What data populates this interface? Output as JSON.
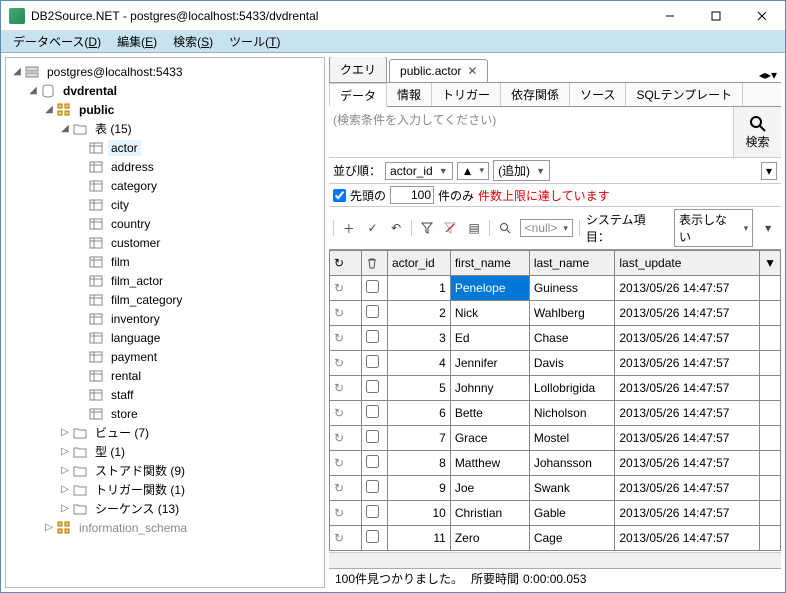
{
  "titlebar": {
    "app": "DB2Source.NET",
    "conn": "postgres@localhost:5433/dvdrental"
  },
  "menu": {
    "database": "データベース",
    "database_u": "D",
    "edit": "編集",
    "edit_u": "E",
    "search": "検索",
    "search_u": "S",
    "tool": "ツール",
    "tool_u": "T"
  },
  "tree": {
    "root": "postgres@localhost:5433",
    "db": "dvdrental",
    "schema": "public",
    "tables_label": "表 (15)",
    "tables": [
      "actor",
      "address",
      "category",
      "city",
      "country",
      "customer",
      "film",
      "film_actor",
      "film_category",
      "inventory",
      "language",
      "payment",
      "rental",
      "staff",
      "store"
    ],
    "views": "ビュー  (7)",
    "types": "型 (1)",
    "funcs": "ストアド関数  (9)",
    "trigs": "トリガー関数  (1)",
    "seqs": "シーケンス  (13)",
    "info": "information_schema",
    "selected_table": "actor"
  },
  "tabs": {
    "query": "クエリ",
    "actor": "public.actor"
  },
  "subtabs": [
    "データ",
    "情報",
    "トリガー",
    "依存関係",
    "ソース",
    "SQLテンプレート"
  ],
  "search": {
    "placeholder": "(検索条件を入力してください)",
    "btn": "検索"
  },
  "sort": {
    "label": "並び順：",
    "col": "actor_id",
    "add": "(追加)"
  },
  "limit": {
    "chk_label": "先頭の",
    "value": "100",
    "suffix": "件のみ",
    "warn": "件数上限に達しています"
  },
  "toolbar": {
    "null": "<null>",
    "sys_label": "システム項目：",
    "sys_value": "表示しない"
  },
  "grid": {
    "cols": [
      "actor_id",
      "first_name",
      "last_name",
      "last_update"
    ],
    "rows": [
      {
        "id": 1,
        "fn": "Penelope",
        "ln": "Guiness",
        "ts": "2013/05/26 14:47:57"
      },
      {
        "id": 2,
        "fn": "Nick",
        "ln": "Wahlberg",
        "ts": "2013/05/26 14:47:57"
      },
      {
        "id": 3,
        "fn": "Ed",
        "ln": "Chase",
        "ts": "2013/05/26 14:47:57"
      },
      {
        "id": 4,
        "fn": "Jennifer",
        "ln": "Davis",
        "ts": "2013/05/26 14:47:57"
      },
      {
        "id": 5,
        "fn": "Johnny",
        "ln": "Lollobrigida",
        "ts": "2013/05/26 14:47:57"
      },
      {
        "id": 6,
        "fn": "Bette",
        "ln": "Nicholson",
        "ts": "2013/05/26 14:47:57"
      },
      {
        "id": 7,
        "fn": "Grace",
        "ln": "Mostel",
        "ts": "2013/05/26 14:47:57"
      },
      {
        "id": 8,
        "fn": "Matthew",
        "ln": "Johansson",
        "ts": "2013/05/26 14:47:57"
      },
      {
        "id": 9,
        "fn": "Joe",
        "ln": "Swank",
        "ts": "2013/05/26 14:47:57"
      },
      {
        "id": 10,
        "fn": "Christian",
        "ln": "Gable",
        "ts": "2013/05/26 14:47:57"
      },
      {
        "id": 11,
        "fn": "Zero",
        "ln": "Cage",
        "ts": "2013/05/26 14:47:57"
      }
    ]
  },
  "status": {
    "count": "100件見つかりました。",
    "time_label": "所要時間",
    "time": "0:00:00.053"
  }
}
